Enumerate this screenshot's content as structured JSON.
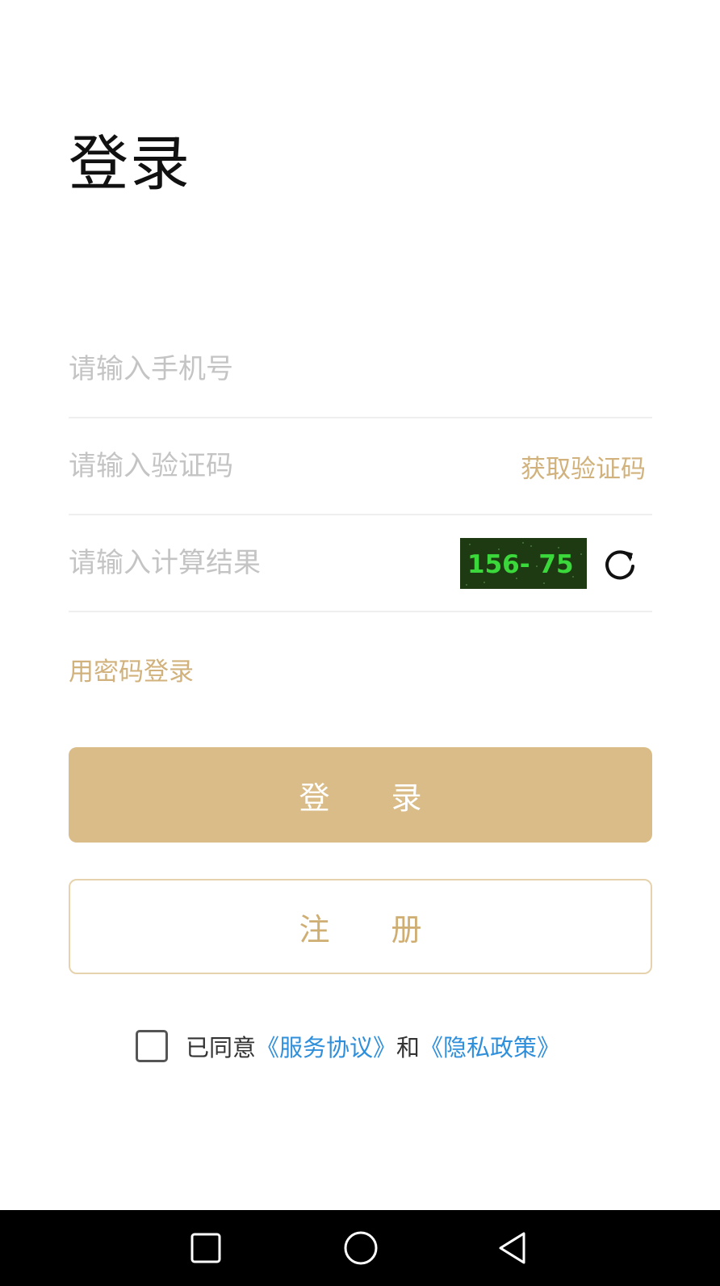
{
  "page": {
    "title": "登录"
  },
  "form": {
    "phone_placeholder": "请输入手机号",
    "code_placeholder": "请输入验证码",
    "get_code_label": "获取验证码",
    "calc_placeholder": "请输入计算结果",
    "captcha_text": "156- 75",
    "password_login_label": "用密码登录"
  },
  "buttons": {
    "login_label": "登　　录",
    "register_label": "注　　册"
  },
  "agreement": {
    "prefix": "已同意",
    "service_link": "《服务协议》",
    "and": "和",
    "privacy_link": "《隐私政策》"
  },
  "colors": {
    "accent": "#d9bc87",
    "link": "#2f8fdb",
    "captcha_bg": "#1e3a12"
  },
  "icons": {
    "refresh": "refresh-icon",
    "nav_recent": "square-icon",
    "nav_home": "circle-icon",
    "nav_back": "triangle-back-icon"
  }
}
